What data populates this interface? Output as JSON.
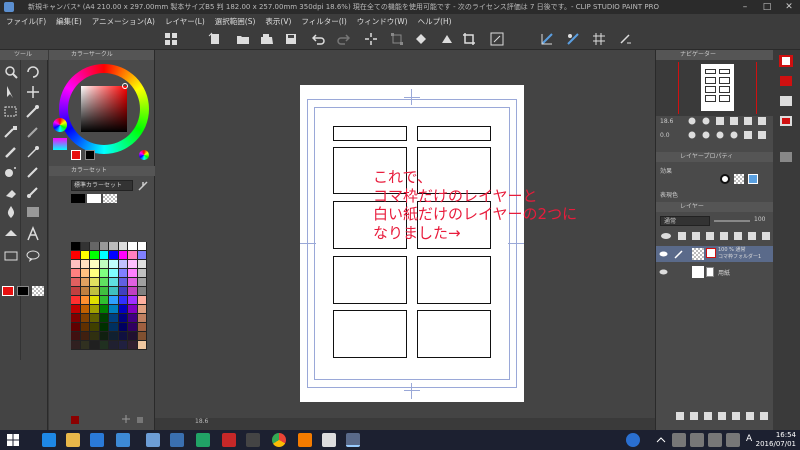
{
  "window": {
    "title": "新規キャンバス* (A4 210.00 x 297.00mm 製本サイズB5 判 182.00 x 257.00mm 350dpi 18.6%) 現在全ての機能を使用可能です - 次のライセンス評価は 7 日後です。- CLIP STUDIO PAINT PRO",
    "minimize": "–",
    "maximize": "□",
    "close": "✕"
  },
  "menu": {
    "items": [
      "ファイル(F)",
      "編集(E)",
      "アニメーション(A)",
      "レイヤー(L)",
      "選択範囲(S)",
      "表示(V)",
      "フィルター(I)",
      "ウィンドウ(W)",
      "ヘルプ(H)"
    ]
  },
  "tool_panel": {
    "header": "ツール"
  },
  "color_panel": {
    "header": "カラーサークル",
    "set_header": "カラーセット",
    "set_name": "標準カラーセット",
    "swatches": [
      "#000000",
      "#333333",
      "#666666",
      "#999999",
      "#bbbbbb",
      "#dddddd",
      "#ffffff",
      "#ffffff",
      "#ff0000",
      "#ffff00",
      "#00ff00",
      "#00ffff",
      "#0000ff",
      "#ff00ff",
      "#ff80c0",
      "#8080ff",
      "#ffc0c0",
      "#ffe0c0",
      "#ffffc0",
      "#c0ffc0",
      "#c0ffff",
      "#c0c0ff",
      "#ffc0ff",
      "#e0e0e0",
      "#ff8080",
      "#ffc080",
      "#ffff80",
      "#80ff80",
      "#80ffff",
      "#8080ff",
      "#ff80ff",
      "#c0c0c0",
      "#e06060",
      "#e0a060",
      "#e0e060",
      "#60e060",
      "#60e0e0",
      "#6060e0",
      "#e060e0",
      "#a0a0a0",
      "#c04040",
      "#c08040",
      "#c0c040",
      "#40c040",
      "#40c0c0",
      "#4040c0",
      "#c040c0",
      "#808080",
      "#ff3030",
      "#ff9030",
      "#e0e000",
      "#30c030",
      "#30a0ff",
      "#3030ff",
      "#a030ff",
      "#ffb0a0",
      "#c00000",
      "#c06000",
      "#a0a000",
      "#008000",
      "#0080c0",
      "#0000c0",
      "#8000c0",
      "#e0a080",
      "#800000",
      "#804000",
      "#606000",
      "#004000",
      "#004080",
      "#000080",
      "#400080",
      "#c08060",
      "#600000",
      "#603000",
      "#404000",
      "#003000",
      "#003060",
      "#000060",
      "#300060",
      "#a06040",
      "#401010",
      "#402010",
      "#303010",
      "#102010",
      "#102030",
      "#101040",
      "#201030",
      "#805030",
      "#302020",
      "#303020",
      "#202020",
      "#203020",
      "#202030",
      "#202040",
      "#302030",
      "#f0c8a0"
    ]
  },
  "canvas": {
    "zoom": "18.6",
    "annotation": [
      "これで、",
      "コマ枠だけのレイヤーと",
      "白い紙だけのレイヤーの2つに",
      "なりました→"
    ]
  },
  "navigator": {
    "header": "ナビゲーター",
    "zoom": "18.6",
    "angle": "0.0"
  },
  "layer_property": {
    "header": "レイヤープロパティ",
    "effect": "効果",
    "expression_color": "表現色"
  },
  "layer_panel": {
    "header": "レイヤー",
    "blend_mode": "通常",
    "opacity": "100",
    "layers": [
      {
        "name": "100 % 通常",
        "sub": "コマ枠フォルダー1",
        "selected": true
      },
      {
        "name": "用紙",
        "sub": "",
        "selected": false
      }
    ]
  },
  "taskbar": {
    "time": "16:54",
    "date": "2016/07/01",
    "ime": "A"
  },
  "colors": {
    "annotation": "#e81c3c",
    "panel_bg": "#4a4a4a",
    "accent_red": "#d01010",
    "guide_blue": "#9aa8d8"
  }
}
